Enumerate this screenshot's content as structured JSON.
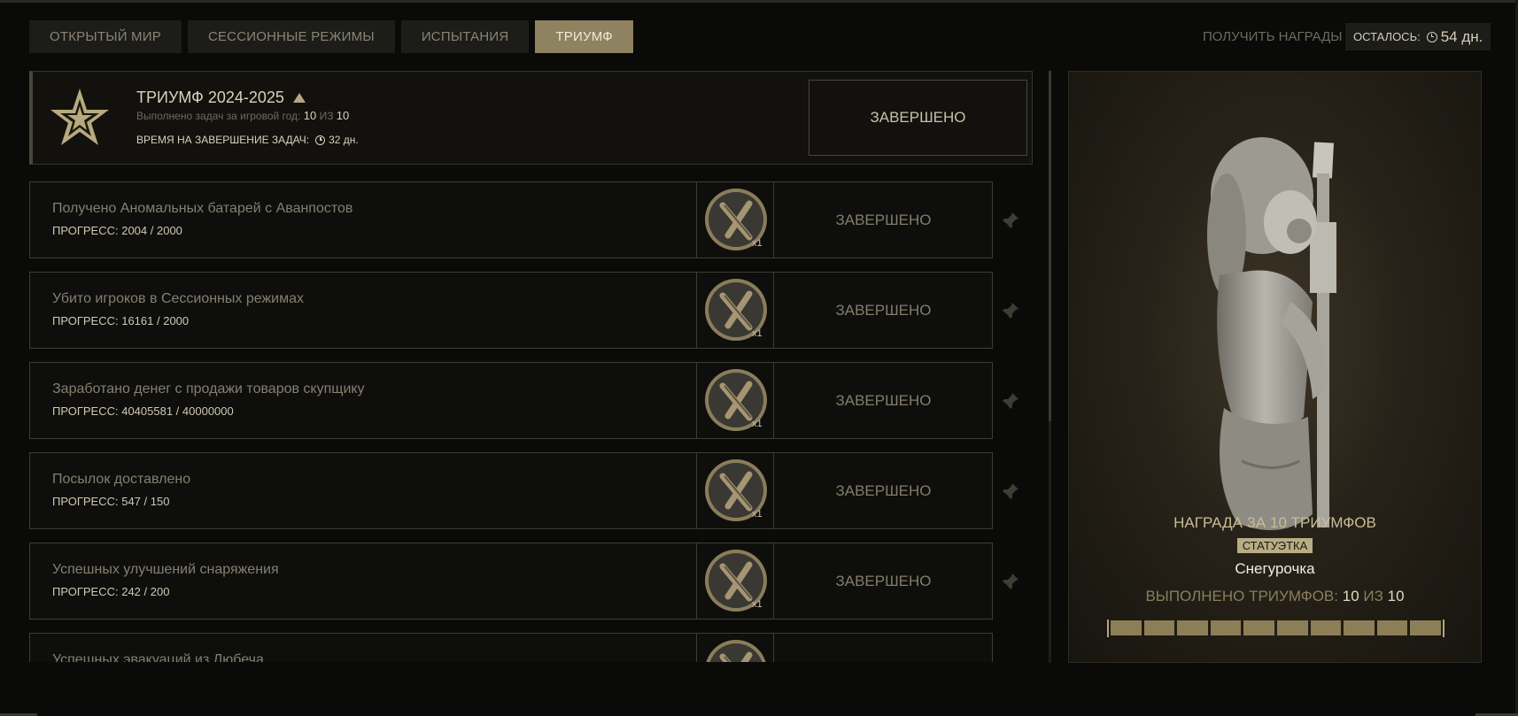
{
  "tabs": [
    {
      "label": "ОТКРЫТЫЙ МИР",
      "active": false
    },
    {
      "label": "СЕССИОННЫЕ РЕЖИМЫ",
      "active": false
    },
    {
      "label": "ИСПЫТАНИЯ",
      "active": false
    },
    {
      "label": "ТРИУМФ",
      "active": true
    }
  ],
  "header": {
    "claim_rewards": "ПОЛУЧИТЬ НАГРАДЫ",
    "remaining_label": "ОСТАЛОСЬ:",
    "remaining_value": "54 дн."
  },
  "triumph": {
    "title": "ТРИУМФ 2024-2025",
    "subtitle_label": "Выполнено задач за игровой год:",
    "done": "10",
    "of_word": "ИЗ",
    "total": "10",
    "time_label": "ВРЕМЯ НА ЗАВЕРШЕНИЕ ЗАДАЧ:",
    "time_value": "32 дн.",
    "status": "ЗАВЕРШЕНО"
  },
  "tasks": [
    {
      "name": "Получено Аномальных батарей с Аванпостов",
      "progress": "ПРОГРЕСС: 2004 / 2000",
      "qty": "x1",
      "status": "ЗАВЕРШЕНО"
    },
    {
      "name": "Убито игроков в Сессионных режимах",
      "progress": "ПРОГРЕСС: 16161 / 2000",
      "qty": "x1",
      "status": "ЗАВЕРШЕНО"
    },
    {
      "name": "Заработано денег с продажи товаров скупщику",
      "progress": "ПРОГРЕСС: 40405581 / 40000000",
      "qty": "x1",
      "status": "ЗАВЕРШЕНО"
    },
    {
      "name": "Посылок доставлено",
      "progress": "ПРОГРЕСС: 547 / 150",
      "qty": "x1",
      "status": "ЗАВЕРШЕНО"
    },
    {
      "name": "Успешных улучшений снаряжения",
      "progress": "ПРОГРЕСС: 242 / 200",
      "qty": "x1",
      "status": "ЗАВЕРШЕНО"
    },
    {
      "name": "Успешных эвакуаций из Любеча",
      "progress": "",
      "qty": "",
      "status": ""
    }
  ],
  "reward": {
    "title": "НАГРАДА ЗА 10 ТРИУМФОВ",
    "badge": "СТАТУЭТКА",
    "name": "Снегурочка",
    "count_label": "ВЫПОЛНЕНО ТРИУМФОВ:",
    "done": "10",
    "of_word": "ИЗ",
    "total": "10",
    "progress_segments_filled": 10,
    "progress_segments_total": 10
  },
  "colors": {
    "accent": "#8f8260",
    "background": "#0a0a08",
    "panel_border": "#3e3c34"
  }
}
